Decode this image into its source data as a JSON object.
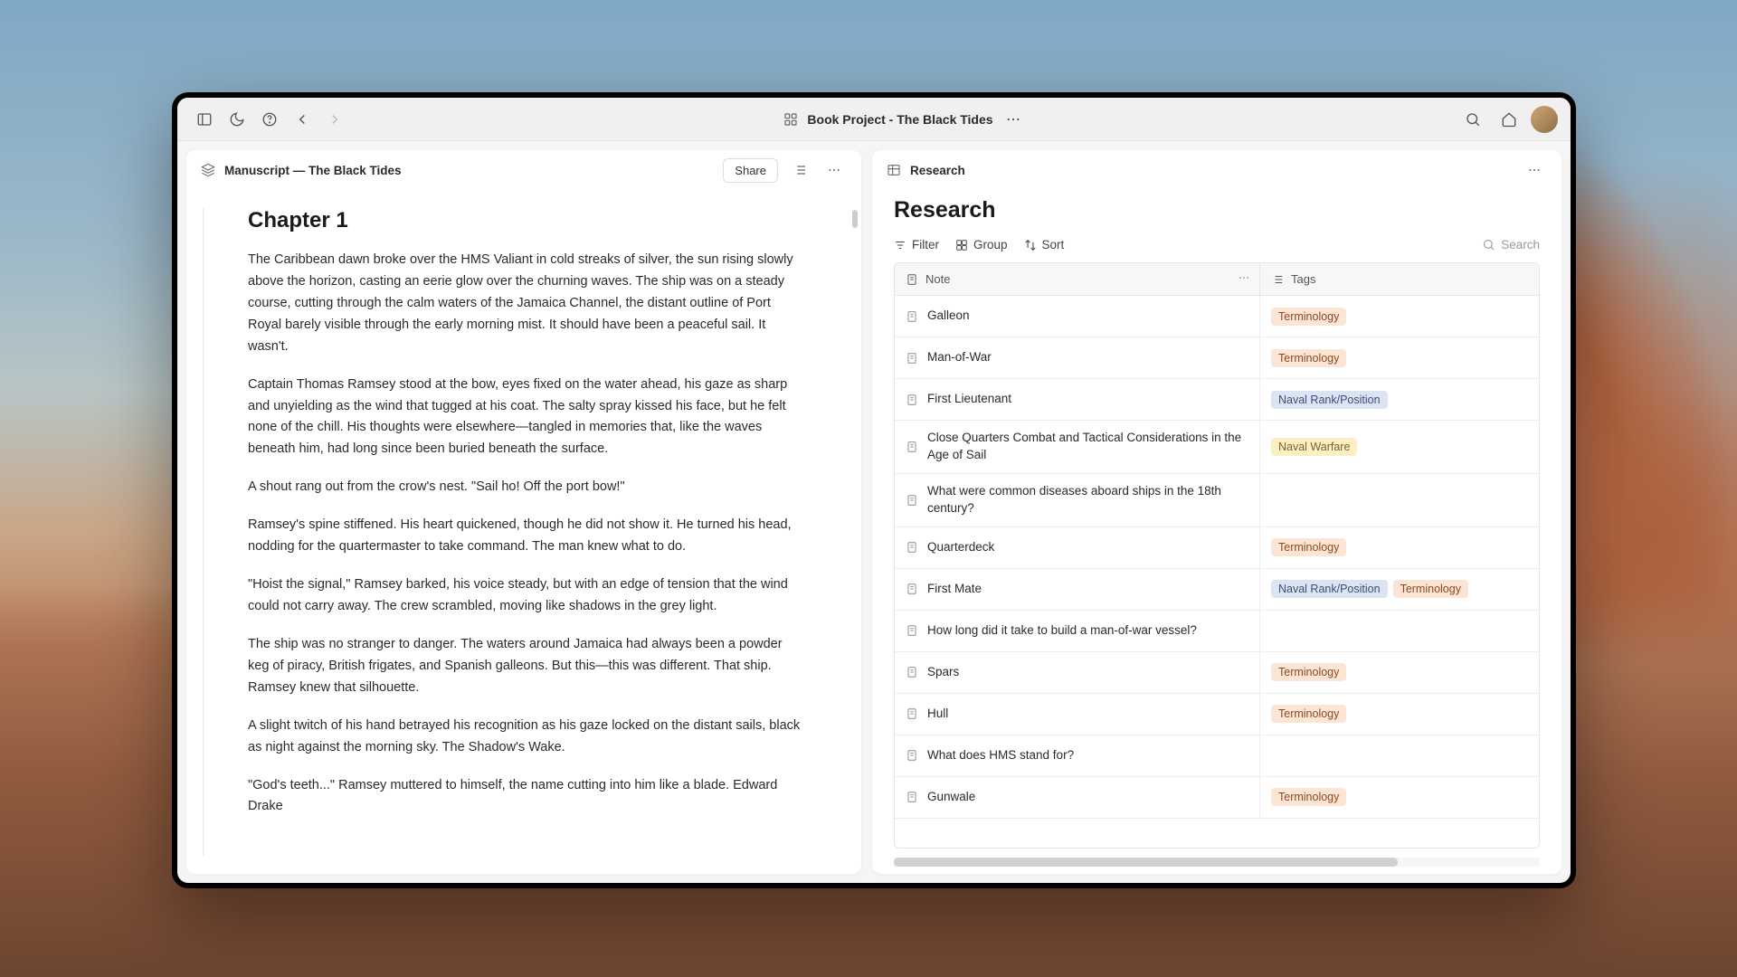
{
  "toolbar": {
    "title": "Book Project - The Black Tides"
  },
  "left_panel": {
    "header_title": "Manuscript — The Black Tides",
    "share_label": "Share",
    "chapter_title": "Chapter 1",
    "paragraphs": [
      "The Caribbean dawn broke over the HMS Valiant in cold streaks of silver, the sun rising slowly above the horizon, casting an eerie glow over the churning waves. The ship was on a steady course, cutting through the calm waters of the Jamaica Channel, the distant outline of Port Royal barely visible through the early morning mist. It should have been a peaceful sail. It wasn't.",
      "Captain Thomas Ramsey stood at the bow, eyes fixed on the water ahead, his gaze as sharp and unyielding as the wind that tugged at his coat. The salty spray kissed his face, but he felt none of the chill. His thoughts were elsewhere—tangled in memories that, like the waves beneath him, had long since been buried beneath the surface.",
      "A shout rang out from the crow's nest. \"Sail ho! Off the port bow!\"",
      "Ramsey's spine stiffened. His heart quickened, though he did not show it. He turned his head, nodding for the quartermaster to take command. The man knew what to do.",
      "\"Hoist the signal,\" Ramsey barked, his voice steady, but with an edge of tension that the wind could not carry away. The crew scrambled, moving like shadows in the grey light.",
      "The ship was no stranger to danger. The waters around Jamaica had always been a powder keg of piracy, British frigates, and Spanish galleons. But this—this was different. That ship. Ramsey knew that silhouette.",
      "A slight twitch of his hand betrayed his recognition as his gaze locked on the distant sails, black as night against the morning sky. The Shadow's Wake.",
      "\"God's teeth...\" Ramsey muttered to himself, the name cutting into him like a blade. Edward Drake"
    ]
  },
  "right_panel": {
    "header_title": "Research",
    "page_title": "Research",
    "controls": {
      "filter": "Filter",
      "group": "Group",
      "sort": "Sort",
      "search_placeholder": "Search"
    },
    "columns": {
      "note": "Note",
      "tags": "Tags"
    },
    "rows": [
      {
        "title": "Galleon",
        "tags": [
          "Terminology"
        ]
      },
      {
        "title": "Man-of-War",
        "tags": [
          "Terminology"
        ]
      },
      {
        "title": "First Lieutenant",
        "tags": [
          "Naval Rank/Position"
        ]
      },
      {
        "title": "Close Quarters Combat and Tactical Considerations in the Age of Sail",
        "tags": [
          "Naval Warfare"
        ]
      },
      {
        "title": "What were common diseases aboard ships in the 18th century?",
        "tags": []
      },
      {
        "title": "Quarterdeck",
        "tags": [
          "Terminology"
        ]
      },
      {
        "title": "First Mate",
        "tags": [
          "Naval Rank/Position",
          "Terminology"
        ]
      },
      {
        "title": "How long did it take to build a man-of-war vessel?",
        "tags": []
      },
      {
        "title": "Spars",
        "tags": [
          "Terminology"
        ]
      },
      {
        "title": "Hull",
        "tags": [
          "Terminology"
        ]
      },
      {
        "title": "What does HMS stand for?",
        "tags": []
      },
      {
        "title": "Gunwale",
        "tags": [
          "Terminology"
        ]
      }
    ],
    "tag_styles": {
      "Terminology": "tag-terminology",
      "Naval Rank/Position": "tag-rank",
      "Naval Warfare": "tag-warfare"
    }
  }
}
